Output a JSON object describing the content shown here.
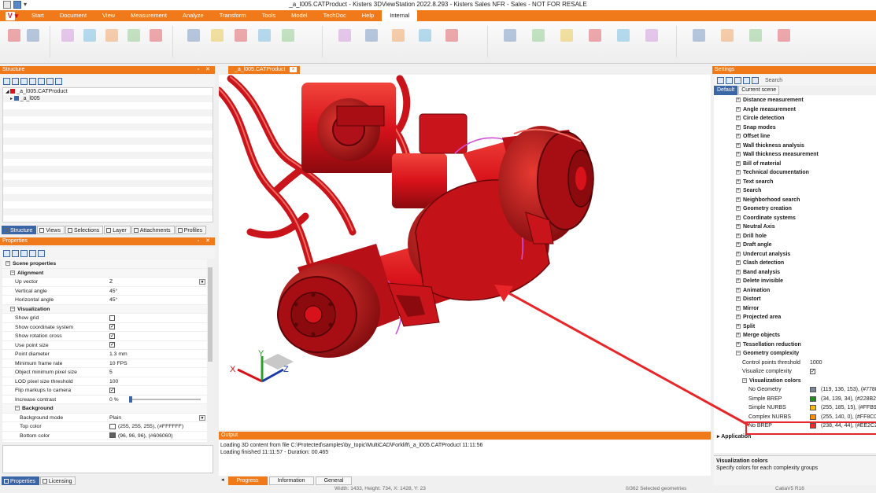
{
  "window": {
    "title": "_a_l005.CATProduct - Kisters 3DViewStation 2022.8.293 - Kisters Sales NFR - Sales - NOT FOR RESALE"
  },
  "ribbon": {
    "app_button": "V",
    "tabs": [
      "Start",
      "Document",
      "View",
      "Measurement",
      "Analyze",
      "Transform",
      "Tools",
      "Model",
      "TechDoc",
      "Help",
      "Internal"
    ],
    "active_tab": "Internal"
  },
  "structure": {
    "title": "Structure",
    "tree": [
      {
        "label": "_a_l005.CATProduct",
        "indent": 0,
        "color": "#d8121a"
      },
      {
        "label": "_a_l005",
        "indent": 1,
        "color": "#3a66a8"
      }
    ],
    "tabs": [
      "Structure",
      "Views",
      "Selections",
      "Layer",
      "Attachments",
      "Profiles"
    ]
  },
  "properties": {
    "title": "Properties",
    "rows": [
      {
        "name": "Scene properties",
        "value": "",
        "kind": "cat",
        "level": 0
      },
      {
        "name": "Alignment",
        "value": "",
        "kind": "cat",
        "level": 1
      },
      {
        "name": "Up vector",
        "value": "Z",
        "kind": "dropdown",
        "level": 2
      },
      {
        "name": "Vertical angle",
        "value": "45°",
        "kind": "text",
        "level": 2
      },
      {
        "name": "Horizontal angle",
        "value": "45°",
        "kind": "text",
        "level": 2
      },
      {
        "name": "Visualization",
        "value": "",
        "kind": "cat",
        "level": 1
      },
      {
        "name": "Show grid",
        "value": "",
        "kind": "check_off",
        "level": 2
      },
      {
        "name": "Show coordinate system",
        "value": "",
        "kind": "check_on",
        "level": 2
      },
      {
        "name": "Show rotation cross",
        "value": "",
        "kind": "check_on",
        "level": 2
      },
      {
        "name": "Use point size",
        "value": "",
        "kind": "check_on",
        "level": 2
      },
      {
        "name": "Point diameter",
        "value": "1.3 mm",
        "kind": "text",
        "level": 2
      },
      {
        "name": "Minimum frame rate",
        "value": "10 FPS",
        "kind": "text",
        "level": 2
      },
      {
        "name": "Object minimum pixel size",
        "value": "5",
        "kind": "text",
        "level": 2
      },
      {
        "name": "LOD pixel size threshold",
        "value": "100",
        "kind": "text",
        "level": 2
      },
      {
        "name": "Flip markups to camera",
        "value": "",
        "kind": "check_on",
        "level": 2
      },
      {
        "name": "Increase contrast",
        "value": "0 %",
        "kind": "slider",
        "level": 2
      },
      {
        "name": "Background",
        "value": "",
        "kind": "cat",
        "level": 2
      },
      {
        "name": "Background mode",
        "value": "Plain",
        "kind": "dropdown",
        "level": 3
      },
      {
        "name": "Top color",
        "value": "(255, 255, 255), (#FFFFFF)",
        "kind": "color",
        "color": "#FFFFFF",
        "level": 3
      },
      {
        "name": "Bottom color",
        "value": "(96, 96, 96), (#606060)",
        "kind": "color",
        "color": "#606060",
        "level": 3
      }
    ],
    "tabs": [
      "Properties",
      "Licensing"
    ]
  },
  "document": {
    "tab_label": "_a_l005.CATProduct",
    "close_icon": "×"
  },
  "axes": {
    "x": "X",
    "y": "Y",
    "z": "Z"
  },
  "output": {
    "title": "Output",
    "lines": [
      "Loading 3D content from file C:\\Protected\\samples\\by_topic\\MultiCAD\\Forklift\\_a_l005.CATProduct 11:11:56",
      "Loading finished 11:11:57 - Duration: 00.465"
    ],
    "tabs": [
      "Progress",
      "Information",
      "General"
    ],
    "active_tab": "Progress"
  },
  "settings": {
    "title": "Settings",
    "search_placeholder": "Search",
    "tabs": [
      "Default",
      "Current scene"
    ],
    "items": [
      "Distance measurement",
      "Angle measurement",
      "Circle detection",
      "Snap modes",
      "Offset line",
      "Wall thickness analysis",
      "Wall thickness measurement",
      "Bill of material",
      "Technical documentation",
      "Text search",
      "Search",
      "Neighborhood search",
      "Geometry creation",
      "Coordinate systems",
      "Neutral Axis",
      "Drill hole",
      "Draft angle",
      "Undercut analysis",
      "Clash detection",
      "Band analysis",
      "Delete invisible",
      "Animation",
      "Distort",
      "Mirror",
      "Projected area",
      "Split",
      "Merge objects",
      "Tessellation reduction"
    ],
    "geometry_complexity": {
      "label": "Geometry complexity",
      "control_points_label": "Control points threshold",
      "control_points_value": "1000",
      "visualize_label": "Visualize complexity",
      "colors_label": "Visualization colors",
      "colors": [
        {
          "name": "No Geometry",
          "value": "(119, 136, 153), (#7788",
          "hex": "#778899"
        },
        {
          "name": "Simple BREP",
          "value": "(34, 139, 34), (#228B22",
          "hex": "#228B22"
        },
        {
          "name": "Simple NURBS",
          "value": "(255, 185, 15), (#FFB90",
          "hex": "#FFB90F"
        },
        {
          "name": "Complex NURBS",
          "value": "(255, 140, 0), (#FF8C00",
          "hex": "#FF8C00"
        },
        {
          "name": "No BREP",
          "value": "(238, 44, 44), (#EE2C2C",
          "hex": "#EE2C2C"
        }
      ]
    },
    "application_label": "Application",
    "description": {
      "title": "Visualization colors",
      "text": "Specify colors for each complexity groups"
    }
  },
  "status": {
    "dimensions": "Width: 1433, Height: 734, X: 1428, Y: 23",
    "selection": "0/362 Selected geometries",
    "version": "CatiaV5 R16"
  },
  "colors": {
    "accent": "#F07A1A",
    "model_red": "#D8121A",
    "annotation_red": "#E8262A"
  }
}
